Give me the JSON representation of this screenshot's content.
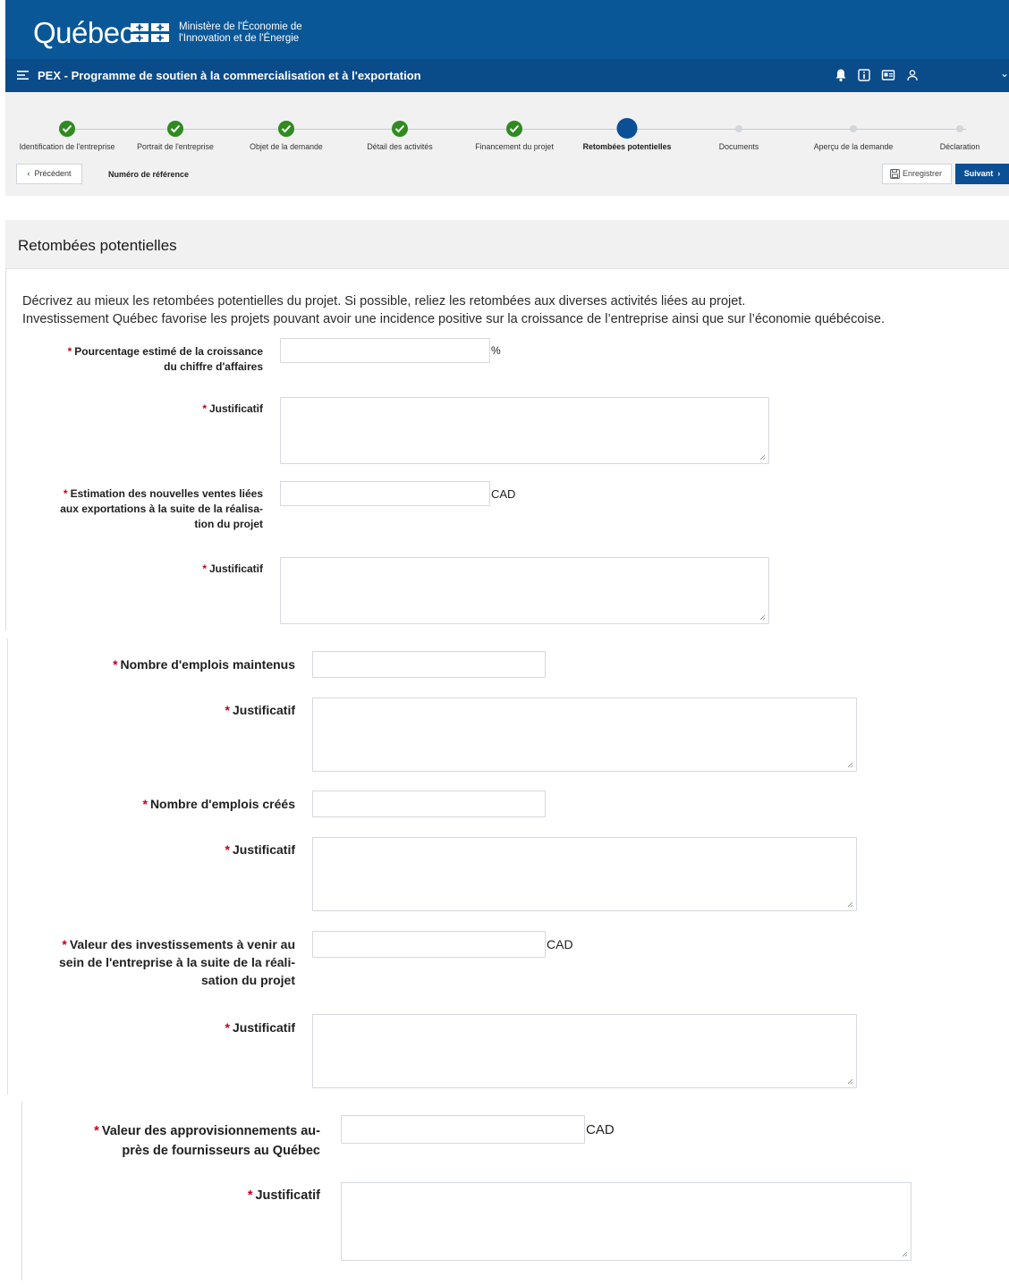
{
  "header": {
    "logo_text": "Québec",
    "ministry_line1": "Ministère de l'Économie de",
    "ministry_line2": "l'Innovation et de l'Énergie",
    "program_title": "PEX - Programme de soutien à la commercialisation et à l'exportation",
    "icons": [
      "bell-icon",
      "info-icon",
      "id-card-icon",
      "user-icon",
      "chevron-down-icon"
    ]
  },
  "stepper": {
    "steps": [
      {
        "label": "Identification de l'entreprise",
        "state": "done"
      },
      {
        "label": "Portrait de l'entreprise",
        "state": "done"
      },
      {
        "label": "Objet de la demande",
        "state": "done"
      },
      {
        "label": "Détail des activités",
        "state": "done"
      },
      {
        "label": "Financement du projet",
        "state": "done"
      },
      {
        "label": "Retombées potentielles",
        "state": "current"
      },
      {
        "label": "Documents",
        "state": "todo"
      },
      {
        "label": "Aperçu de la demande",
        "state": "todo"
      },
      {
        "label": "Déclaration",
        "state": "todo"
      }
    ],
    "prev_label": "Précédent",
    "reference_label": "Numéro de référence",
    "save_label": "Enregistrer",
    "next_label": "Suivant"
  },
  "section": {
    "title": "Retombées potentielles",
    "intro_line1": "Décrivez au mieux les retombées potentielles du projet. Si possible, reliez les retombées aux diverses activités liées au projet.",
    "intro_line2": "Investissement Québec favorise les projets pouvant avoir une incidence positive sur la croissance de l’entreprise ainsi que sur l’économie québécoise."
  },
  "form": {
    "required_mark": "*",
    "growth_label_1": "Pourcentage estimé de la croissance",
    "growth_label_2": "du chiffre d'affaires",
    "growth_value": "",
    "growth_unit": "%",
    "justif_label": "Justificatif",
    "export_label_1": "Estimation des nouvelles ventes liées",
    "export_label_2": "aux exportations à la suite de la réalisa-",
    "export_label_3": "tion du projet",
    "export_value": "",
    "export_unit": "CAD",
    "jobs_kept_label": "Nombre d'emplois maintenus",
    "jobs_kept_value": "",
    "jobs_created_label": "Nombre d'emplois créés",
    "jobs_created_value": "",
    "invest_label_1": "Valeur des investissements à venir au",
    "invest_label_2": "sein de l'entreprise à la suite de la réali-",
    "invest_label_3": "sation du projet",
    "invest_value": "",
    "invest_unit": "CAD",
    "supply_label_1": "Valeur des approvisionnements au-",
    "supply_label_2": "près de fournisseurs au Québec",
    "supply_value": "",
    "supply_unit": "CAD"
  },
  "colors": {
    "brand_blue": "#095797",
    "nav_blue": "#0a4b8a",
    "done_green": "#2f8b1f",
    "required_red": "#c00020"
  }
}
